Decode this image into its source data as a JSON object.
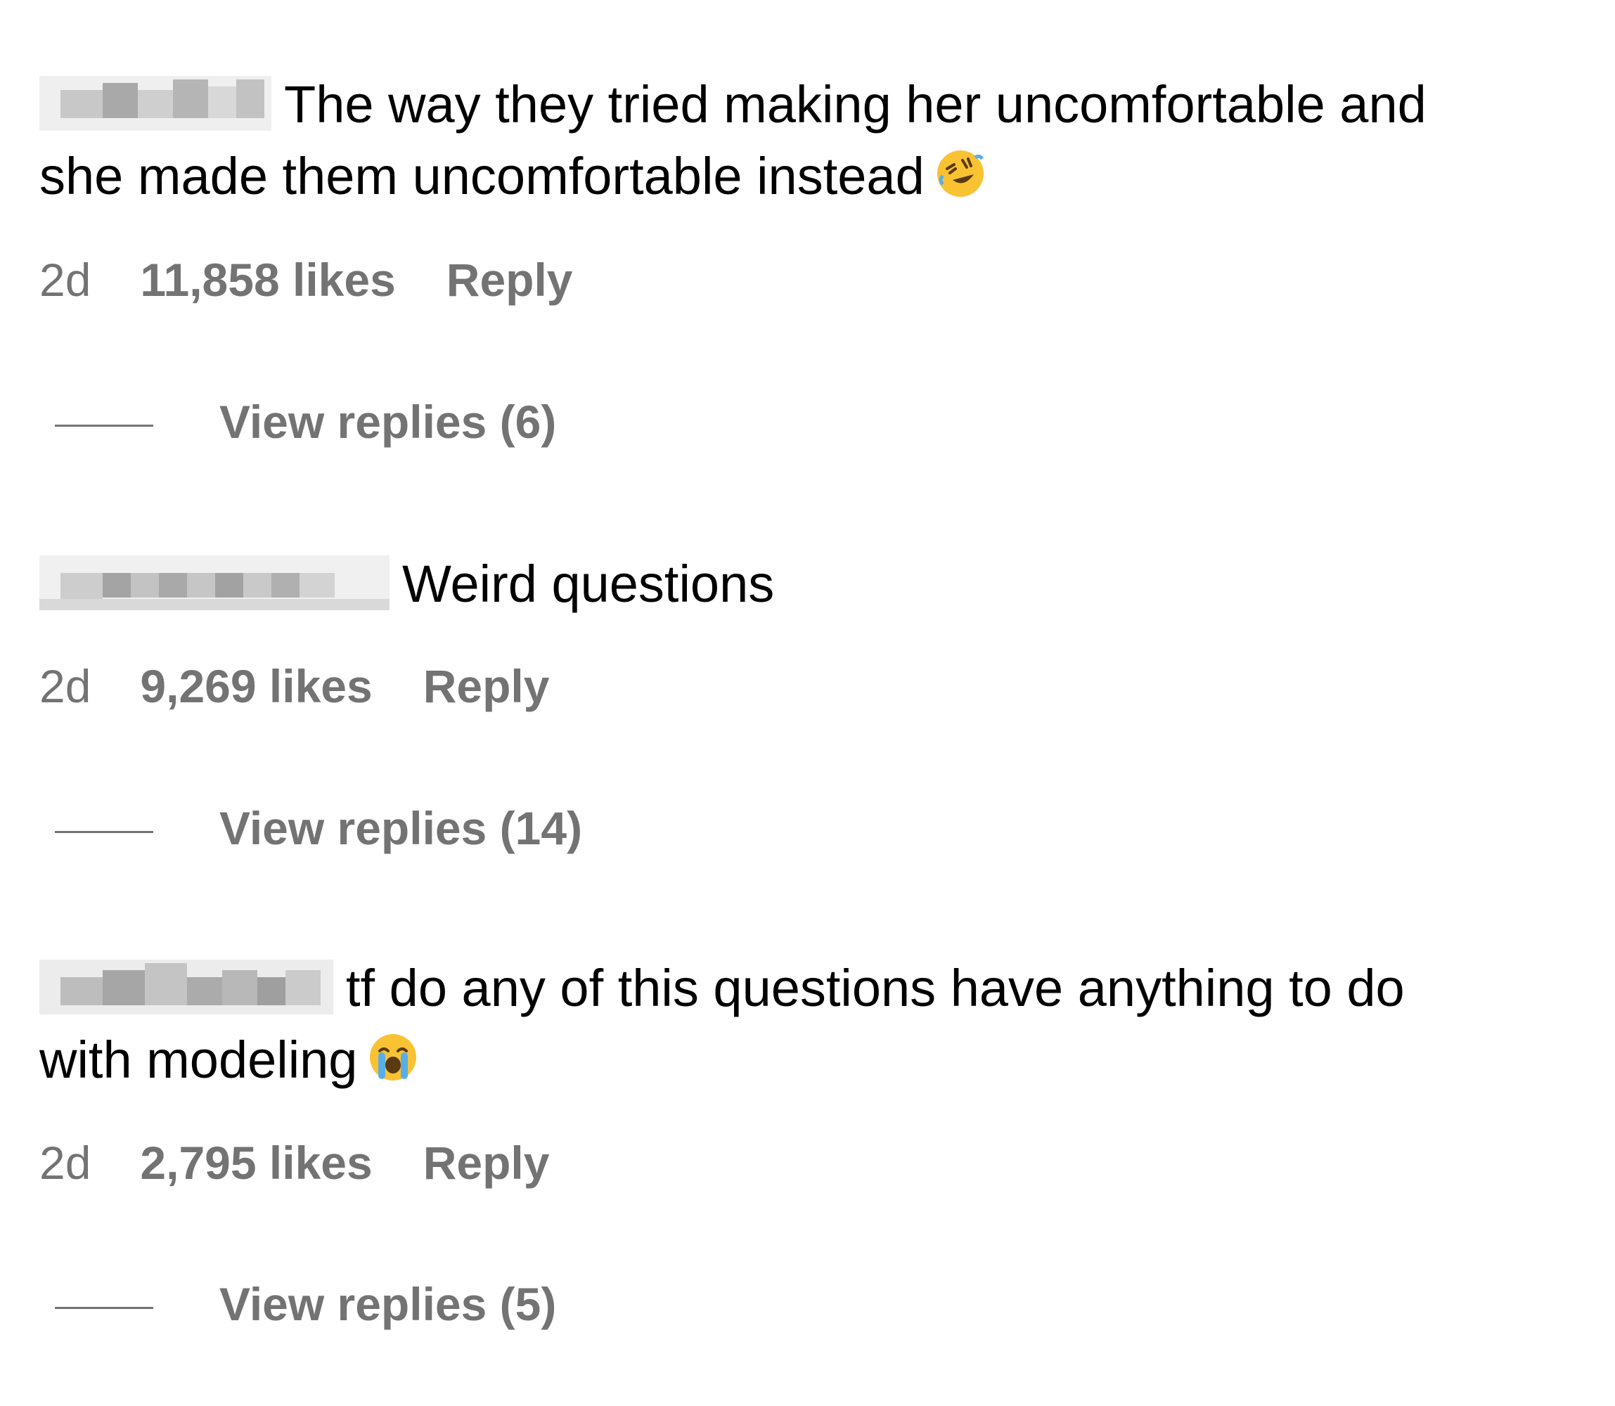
{
  "comments": [
    {
      "text_lines": [
        "The way they tried making her uncomfortable and",
        "she made them uncomfortable instead"
      ],
      "emoji": "rolling-on-floor-laughing",
      "time": "2d",
      "likes": "11,858 likes",
      "reply": "Reply",
      "view_replies": "View replies (6)"
    },
    {
      "text_lines": [
        "Weird questions"
      ],
      "time": "2d",
      "likes": "9,269 likes",
      "reply": "Reply",
      "view_replies": "View replies (14)"
    },
    {
      "text_lines": [
        "tf do any of this questions have anything to do",
        "with modeling"
      ],
      "emoji": "loudly-crying-face",
      "time": "2d",
      "likes": "2,795 likes",
      "reply": "Reply",
      "view_replies": "View replies (5)"
    }
  ],
  "colors": {
    "text": "#000000",
    "meta": "#737373",
    "emoji_yellow": "#F9C233",
    "tears_blue": "#5AAEE8"
  }
}
